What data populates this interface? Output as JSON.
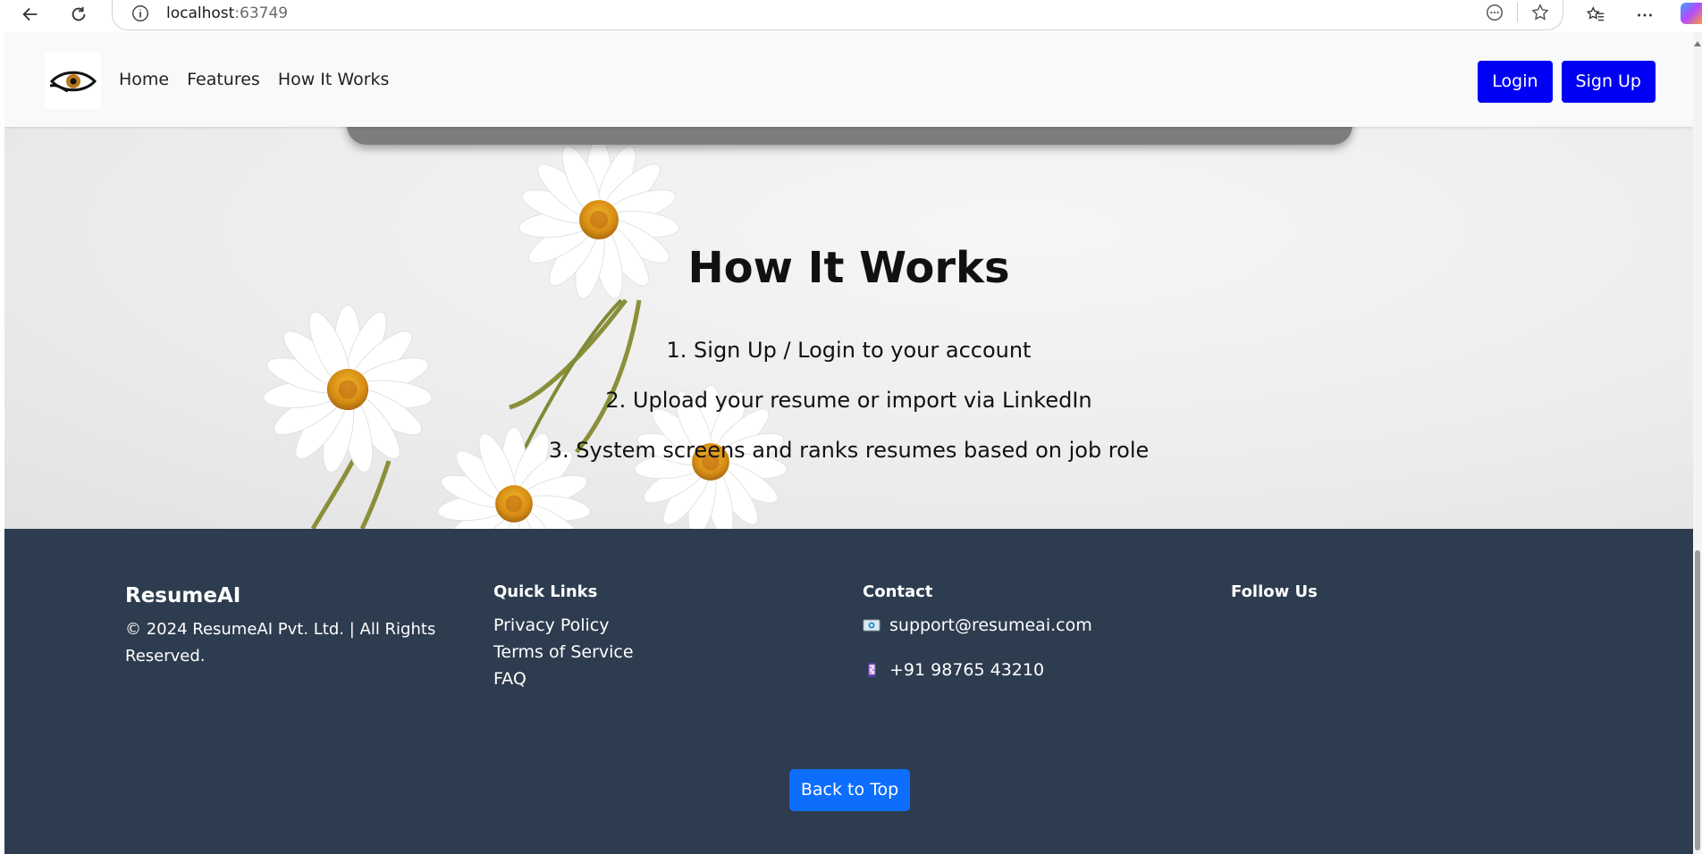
{
  "browser": {
    "url_host": "localhost",
    "url_port": ":63749"
  },
  "navbar": {
    "links": [
      "Home",
      "Features",
      "How It Works"
    ],
    "login_label": "Login",
    "signup_label": "Sign Up"
  },
  "hero": {
    "title": "How It Works",
    "steps": [
      "1. Sign Up / Login to your account",
      "2. Upload your resume or import via LinkedIn",
      "3. System screens and ranks resumes based on job role"
    ]
  },
  "footer": {
    "brand": "ResumeAI",
    "copyright": "© 2024 ResumeAI Pvt. Ltd. | All Rights Reserved.",
    "quick_links_title": "Quick Links",
    "quick_links": [
      "Privacy Policy",
      "Terms of Service",
      "FAQ"
    ],
    "contact_title": "Contact",
    "email": "support@resumeai.com",
    "phone": "+91 98765 43210",
    "follow_title": "Follow Us",
    "back_to_top": "Back to Top"
  },
  "colors": {
    "nav_button": "#0000f5",
    "footer_bg": "#2d3c4f",
    "back_to_top": "#0d6efd"
  }
}
